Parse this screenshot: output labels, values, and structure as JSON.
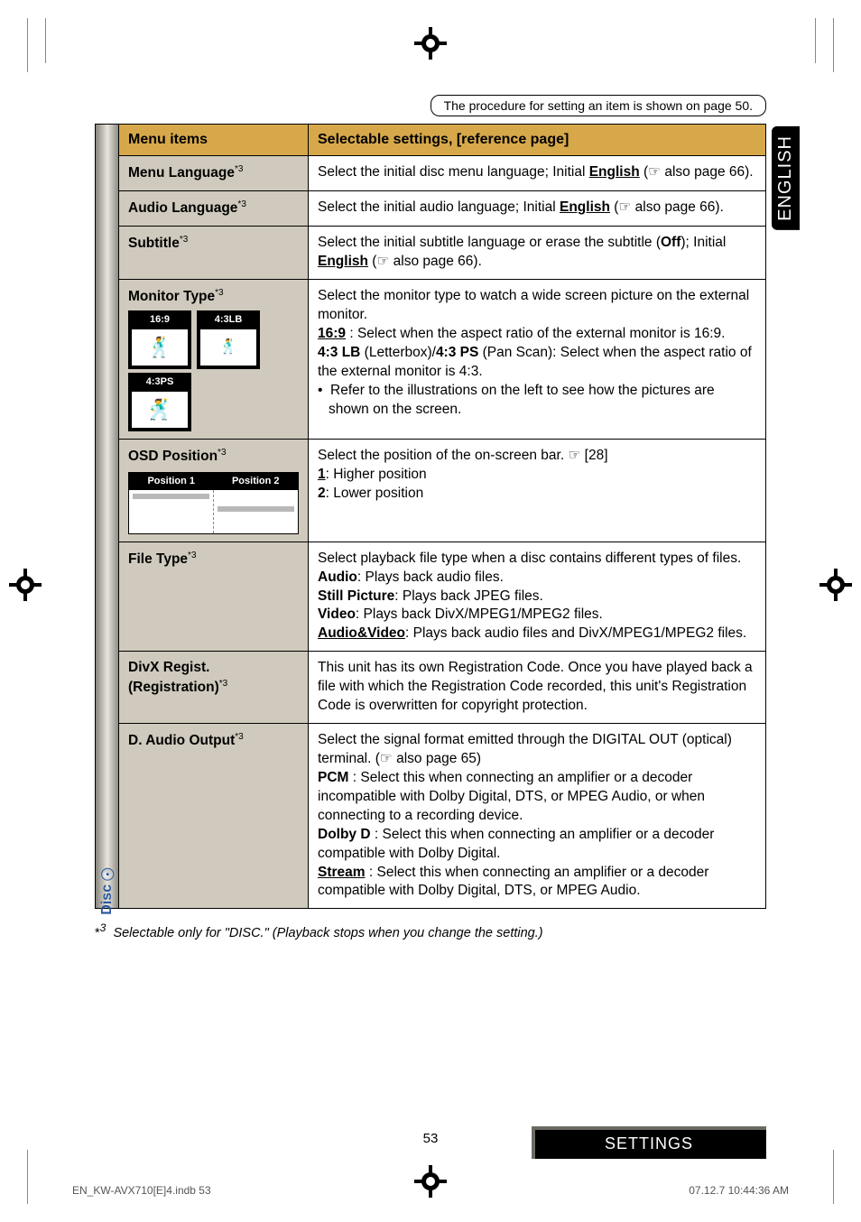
{
  "procedure_note": "The procedure for setting an item is shown on page 50.",
  "side_tab": "ENGLISH",
  "disc_tab": "Disc",
  "headers": {
    "items": "Menu items",
    "settings": "Selectable settings, [reference page]"
  },
  "rows": {
    "menu_language": {
      "label": "Menu Language",
      "sup": "*3",
      "desc_pre": "Select the initial disc menu language; Initial ",
      "desc_link": "English",
      "desc_post": " (☞ also page 66)."
    },
    "audio_language": {
      "label": "Audio Language",
      "sup": "*3",
      "desc_pre": "Select the initial audio language; Initial ",
      "desc_link": "English",
      "desc_post": " (☞ also page 66)."
    },
    "subtitle": {
      "label": "Subtitle",
      "sup": "*3",
      "desc_line1_pre": "Select the initial subtitle language or erase the subtitle (",
      "desc_line1_bold": "Off",
      "desc_line1_post": "); Initial ",
      "desc_link": "English",
      "desc_post": " (☞ also page 66)."
    },
    "monitor_type": {
      "label": "Monitor Type",
      "sup": "*3",
      "ratio_169": "16:9",
      "ratio_43lb": "4:3LB",
      "ratio_43ps": "4:3PS",
      "desc_l1": "Select the monitor type to watch a wide screen picture on the external monitor.",
      "desc_169": "16:9",
      "desc_169_rest": " : Select when the aspect ratio of the external monitor is 16:9.",
      "desc_43a": "4:3 LB",
      "desc_43mid": " (Letterbox)/",
      "desc_43b": "4:3 PS",
      "desc_43_rest": " (Pan Scan): Select when the aspect ratio of the external monitor is 4:3.",
      "desc_bullet": "Refer to the illustrations on the left to see how the pictures are shown on the screen."
    },
    "osd": {
      "label": "OSD Position",
      "sup": "*3",
      "pos1": "Position 1",
      "pos2": "Position 2",
      "desc_l1": "Select the position of the on-screen bar. ☞ [28]",
      "desc_1": "1",
      "desc_1_rest": ": Higher position",
      "desc_2": "2",
      "desc_2_rest": ": Lower position"
    },
    "file_type": {
      "label": "File Type",
      "sup": "*3",
      "l1": "Select playback file type when a disc contains different types of files.",
      "audio_b": "Audio",
      "audio_r": ": Plays back audio files.",
      "still_b": "Still Picture",
      "still_r": ": Plays back JPEG files.",
      "video_b": "Video",
      "video_r": ": Plays back DivX/MPEG1/MPEG2 files.",
      "av_b": "Audio&Video",
      "av_r": ": Plays back audio files and DivX/MPEG1/MPEG2 files."
    },
    "divx": {
      "label": "DivX Regist. (Registration)",
      "sup": "*3",
      "desc": "This unit has its own Registration Code. Once you have played back a file with which the Registration Code recorded, this unit's Registration Code is overwritten for copyright protection."
    },
    "daudio": {
      "label": "D. Audio Output",
      "sup": "*3",
      "l1": "Select the signal format emitted through the DIGITAL OUT (optical) terminal. (☞ also page 65)",
      "pcm_b": "PCM",
      "pcm_r": " : Select this when connecting an amplifier or a decoder incompatible with Dolby Digital, DTS, or MPEG Audio, or when connecting to a recording device.",
      "dolby_b": "Dolby D",
      "dolby_r": " : Select this when connecting an amplifier or a decoder compatible with Dolby Digital.",
      "stream_b": "Stream",
      "stream_r": " : Select this when connecting an amplifier or a decoder compatible with Dolby Digital, DTS, or MPEG Audio."
    }
  },
  "footnote": {
    "mark": "*",
    "num": "3",
    "text": "Selectable only for \"DISC.\" (Playback stops when you change the setting.)"
  },
  "page_number": "53",
  "settings_label": "SETTINGS",
  "footer_left": "EN_KW-AVX710[E]4.indb   53",
  "footer_right": "07.12.7   10:44:36 AM"
}
